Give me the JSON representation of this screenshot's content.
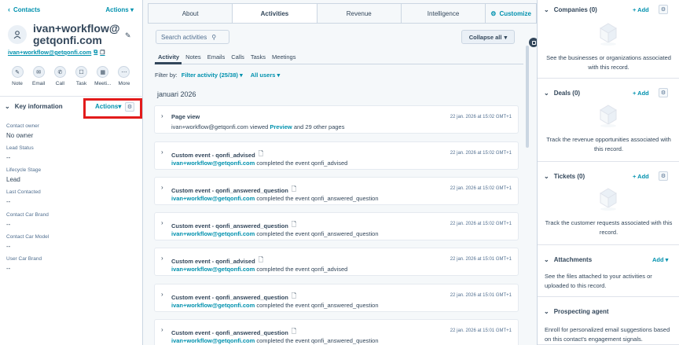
{
  "left": {
    "back_label": "Contacts",
    "actions_label": "Actions",
    "contact_name": "ivan+workflow@getqonfi.com",
    "email": "ivan+workflow@getqonfi.com",
    "quick_actions": [
      {
        "label": "Note",
        "icon": "pencil-icon"
      },
      {
        "label": "Email",
        "icon": "envelope-icon"
      },
      {
        "label": "Call",
        "icon": "phone-icon"
      },
      {
        "label": "Task",
        "icon": "task-icon"
      },
      {
        "label": "Meeti...",
        "icon": "calendar-icon"
      },
      {
        "label": "More",
        "icon": "ellipsis-icon"
      }
    ],
    "key_info_title": "Key information",
    "key_info_actions": "Actions",
    "properties": [
      {
        "label": "Contact owner",
        "value": "No owner"
      },
      {
        "label": "Lead Status",
        "value": "--"
      },
      {
        "label": "Lifecycle Stage",
        "value": "Lead"
      },
      {
        "label": "Last Contacted",
        "value": "--"
      },
      {
        "label": "Contact Car Brand",
        "value": "--"
      },
      {
        "label": "Contact Car Model",
        "value": "--"
      },
      {
        "label": "User Car Brand",
        "value": "--"
      }
    ]
  },
  "center": {
    "tabs": [
      "About",
      "Activities",
      "Revenue",
      "Intelligence",
      "Customize"
    ],
    "active_tab": "Activities",
    "search_placeholder": "Search activities",
    "collapse_label": "Collapse all",
    "subtabs": [
      "Activity",
      "Notes",
      "Emails",
      "Calls",
      "Tasks",
      "Meetings"
    ],
    "filter_by_label": "Filter by:",
    "filter_activity": "Filter activity (25/38)",
    "filter_users": "All users",
    "month": "januari 2026",
    "activities": [
      {
        "title": "Page view",
        "note": false,
        "desc_pre": "ivan+workflow@getqonfi.com viewed ",
        "desc_em": "Preview",
        "desc_post": " and 29 other pages",
        "time": "22 jan. 2026 at 15:02 GMT+1"
      },
      {
        "title": "Custom event - qonfi_advised",
        "note": true,
        "desc_pre": "",
        "desc_em": "ivan+workflow@getqonfi.com",
        "desc_post": " completed the event qonfi_advised",
        "time": "22 jan. 2026 at 15:02 GMT+1"
      },
      {
        "title": "Custom event - qonfi_answered_question",
        "note": true,
        "desc_pre": "",
        "desc_em": "ivan+workflow@getqonfi.com",
        "desc_post": " completed the event qonfi_answered_question",
        "time": "22 jan. 2026 at 15:02 GMT+1"
      },
      {
        "title": "Custom event - qonfi_answered_question",
        "note": true,
        "desc_pre": "",
        "desc_em": "ivan+workflow@getqonfi.com",
        "desc_post": " completed the event qonfi_answered_question",
        "time": "22 jan. 2026 at 15:02 GMT+1"
      },
      {
        "title": "Custom event - qonfi_advised",
        "note": true,
        "desc_pre": "",
        "desc_em": "ivan+workflow@getqonfi.com",
        "desc_post": " completed the event qonfi_advised",
        "time": "22 jan. 2026 at 15:01 GMT+1"
      },
      {
        "title": "Custom event - qonfi_answered_question",
        "note": true,
        "desc_pre": "",
        "desc_em": "ivan+workflow@getqonfi.com",
        "desc_post": " completed the event qonfi_answered_question",
        "time": "22 jan. 2026 at 15:01 GMT+1"
      },
      {
        "title": "Custom event - qonfi_answered_question",
        "note": true,
        "desc_pre": "",
        "desc_em": "ivan+workflow@getqonfi.com",
        "desc_post": " completed the event qonfi_answered_question",
        "time": "22 jan. 2026 at 15:01 GMT+1"
      }
    ]
  },
  "right": {
    "sections": [
      {
        "title": "Companies (0)",
        "add": "+ Add",
        "message": "See the businesses or organizations associated with this record."
      },
      {
        "title": "Deals (0)",
        "add": "+ Add",
        "message": "Track the revenue opportunities associated with this record."
      },
      {
        "title": "Tickets (0)",
        "add": "+ Add",
        "message": "Track the customer requests associated with this record."
      },
      {
        "title": "Attachments",
        "add": "Add",
        "message": "See the files attached to your activities or uploaded to this record."
      },
      {
        "title": "Prospecting agent",
        "add": "",
        "message": "Enroll for personalized email suggestions based on this contact's engagement signals."
      }
    ]
  },
  "colors": {
    "accent": "#0091ae",
    "text": "#33475b",
    "highlight": "#e21b1b"
  }
}
